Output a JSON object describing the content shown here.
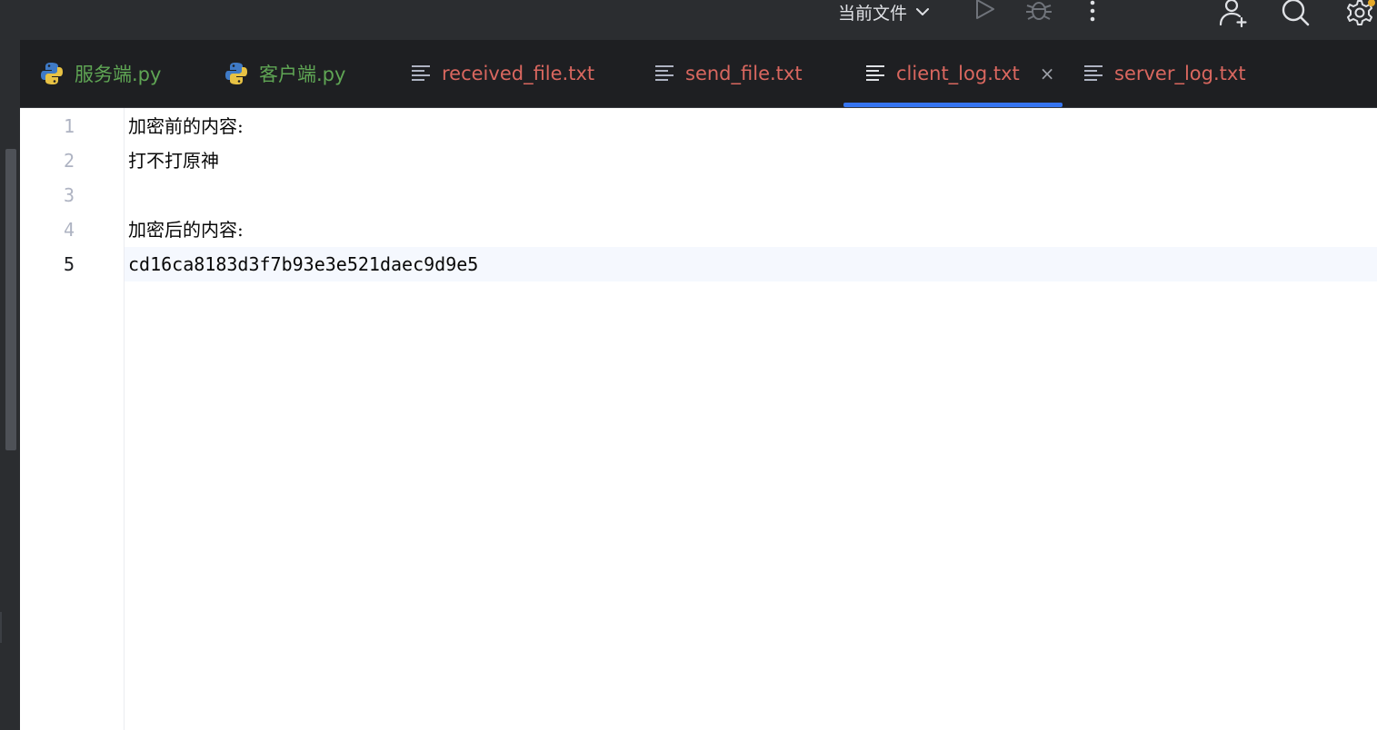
{
  "toolbar": {
    "run_config_label": "当前文件",
    "icons": [
      "chevron-down-icon",
      "run-icon",
      "debug-icon",
      "more-vertical-icon",
      "add-user-icon",
      "search-icon",
      "settings-icon"
    ]
  },
  "tabs": [
    {
      "label": "服务端.py",
      "type": "python",
      "active": false
    },
    {
      "label": "客户端.py",
      "type": "python",
      "active": false
    },
    {
      "label": "received_file.txt",
      "type": "text",
      "active": false
    },
    {
      "label": "send_file.txt",
      "type": "text",
      "active": false
    },
    {
      "label": "client_log.txt",
      "type": "text",
      "active": true,
      "close_symbol": "×"
    },
    {
      "label": "server_log.txt",
      "type": "text",
      "active": false
    }
  ],
  "editor": {
    "line_numbers": [
      "1",
      "2",
      "3",
      "4",
      "5"
    ],
    "current_line": 5,
    "lines": [
      "加密前的内容:",
      "打不打原神",
      "",
      "加密后的内容:",
      "cd16ca8183d3f7b93e3e521daec9d9e5"
    ]
  },
  "colors": {
    "accent": "#3574f0",
    "python_tab": "#5fa554",
    "text_tab": "#d9675f",
    "toolbar_bg": "#2b2d30",
    "editor_bg": "#ffffff"
  }
}
